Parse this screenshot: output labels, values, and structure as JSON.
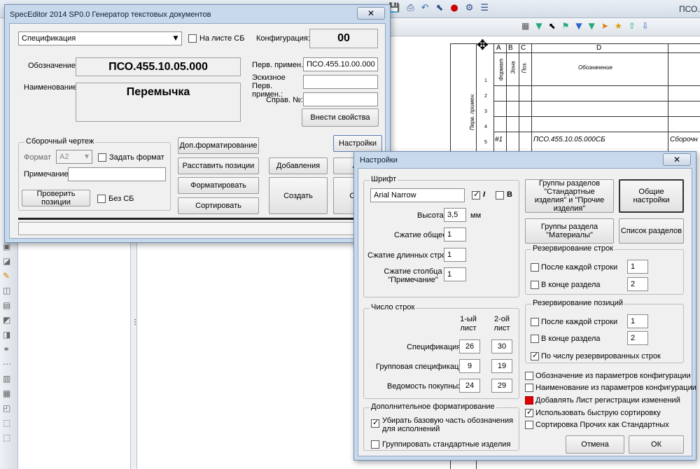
{
  "background": {
    "title_right": "ПСО.",
    "grid_col_headers": [
      "A",
      "B",
      "C",
      "D"
    ],
    "grid_vertical_headers": [
      "Формат",
      "Зона",
      "Поз.",
      "Обозначение"
    ],
    "grid_row_numbers": [
      "1",
      "2",
      "3",
      "4",
      "5"
    ],
    "grid_side_label": "Перв. примен.",
    "row_first": "#1",
    "row_designation": "ПСО.455.10.05.000СБ",
    "row_name": "Сборочн"
  },
  "main": {
    "title": "SpecEditor 2014 SP0.0   Генератор текстовых документов",
    "close": "✕",
    "doc_type": "Спецификация",
    "on_sheet_label": "На листе СБ",
    "config_label": "Конфигурация:",
    "config_value": "00",
    "designation_label": "Обозначение:",
    "designation_value": "ПСО.455.10.05.000",
    "name_label": "Наименование:",
    "name_value": "Перемычка",
    "first_use_label": "Перв. примен.:",
    "first_use_value": "ПСО.455.10.00.000",
    "sketch_label": "Эскизное Перв. примен.:",
    "ref_label": "Справ. №:",
    "apply_button": "Внести свойства",
    "assembly_group": "Сборочный чертеж",
    "format_label": "Формат",
    "format_value": "А2",
    "set_format_label": "Задать формат",
    "note_label": "Примечание",
    "check_button": "Проверить позиции",
    "no_sb_label": "Без СБ",
    "extra_format_button": "Доп.форматирование",
    "place_button": "Расставить позиции",
    "format_button": "Форматировать",
    "sort_button": "Сортировать",
    "additions_button": "Добавления",
    "create_button": "Создать",
    "settings_button": "Настройки",
    "cut_a": "А",
    "cut_ot": "От"
  },
  "settings": {
    "title": "Настройки",
    "close": "✕",
    "font_group": "Шрифт",
    "font_value": "Arial Narrow",
    "italic": "I",
    "bold": "B",
    "height_label": "Высота",
    "height_value": "3,5",
    "height_unit": "мм",
    "compress_label": "Сжатие общее",
    "compress_value": "1",
    "long_label": "Сжатие длинных строк",
    "long_value": "1",
    "col_label": "Сжатие столбца \"Примечание\"",
    "col_value": "1",
    "lines_group": "Число строк",
    "first_sheet": "1-ый лист",
    "other_sheet": "2-ой лист",
    "rows": [
      {
        "label": "Спецификация",
        "a": "26",
        "b": "30"
      },
      {
        "label": "Групповая спецификация",
        "a": "9",
        "b": "19"
      },
      {
        "label": "Ведомость покупных",
        "a": "24",
        "b": "29"
      }
    ],
    "extra_group": "Дополнительное форматирование",
    "remove_base": "Убирать базовую часть обозначения для исполнений",
    "group_std": "Группировать стандартные изделия",
    "groups_std_button": "Группы разделов \"Стандартные изделия\" и \"Прочие изделия\"",
    "general_button": "Общие настройки",
    "groups_mat_button": "Группы раздела \"Материалы\"",
    "sections_button": "Список разделов",
    "reserve_rows_group": "Резервирование строк",
    "after_each_row": "После каждой строки",
    "after_each_row_value": "1",
    "section_end": "В конце раздела",
    "section_end_value": "2",
    "reserve_pos_group": "Резервирование позиций",
    "after_each_pos": "После каждой строки",
    "after_each_pos_value": "1",
    "pos_section_end": "В конце раздела",
    "pos_section_end_value": "2",
    "by_count": "По числу резервированных строк",
    "opt1": "Обозначение из параметров конфигурации",
    "opt2": "Наименование из параметров конфигурации",
    "opt3": "Добавлять Лист регистрации изменений",
    "opt4": "Использовать быструю сортировку",
    "opt5": "Сортировка Прочих как Стандартных",
    "cancel_button": "Отмена",
    "ok_button": "ОК",
    "red_color": "#e00000"
  }
}
